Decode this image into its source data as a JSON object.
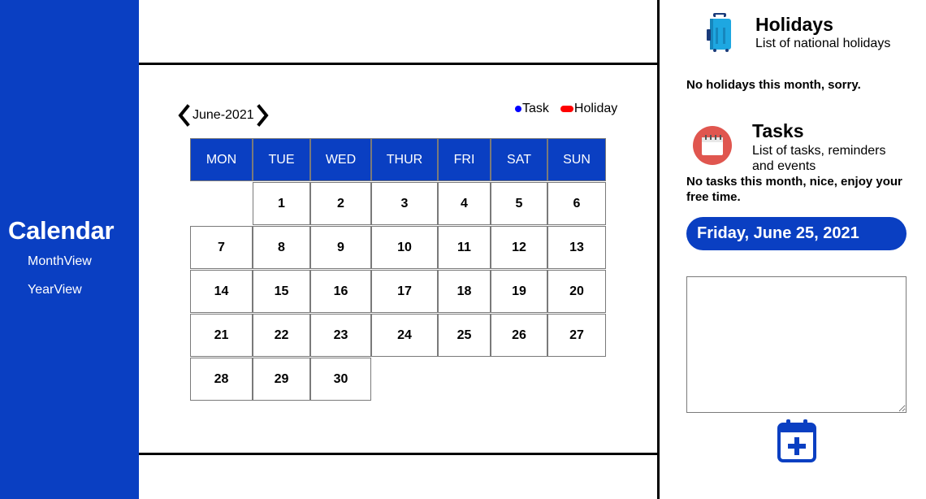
{
  "sidebar": {
    "title": "Calendar",
    "nav": [
      {
        "label": "MonthView"
      },
      {
        "label": "YearView"
      }
    ]
  },
  "calendar": {
    "month_label": "June-2021",
    "legend": {
      "task": "Task",
      "holiday": "Holiday"
    },
    "weekdays": [
      "MON",
      "TUE",
      "WED",
      "THUR",
      "FRI",
      "SAT",
      "SUN"
    ],
    "weeks": [
      [
        "",
        "1",
        "2",
        "3",
        "4",
        "5",
        "6"
      ],
      [
        "7",
        "8",
        "9",
        "10",
        "11",
        "12",
        "13"
      ],
      [
        "14",
        "15",
        "16",
        "17",
        "18",
        "19",
        "20"
      ],
      [
        "21",
        "22",
        "23",
        "24",
        "25",
        "26",
        "27"
      ],
      [
        "28",
        "29",
        "30",
        "",
        "",
        "",
        ""
      ]
    ]
  },
  "holidays": {
    "title": "Holidays",
    "subtitle": "List of national holidays",
    "empty_message": "No holidays this month, sorry."
  },
  "tasks": {
    "title": "Tasks",
    "subtitle": "List of tasks, reminders and events",
    "empty_message": "No tasks this month, nice, enjoy your free time."
  },
  "selected_date": "Friday, June 25, 2021",
  "colors": {
    "accent": "#0a3fc2",
    "task_dot": "#0000ff",
    "holiday_dot": "#ff0000"
  },
  "icons": {
    "holidays": "suitcase-icon",
    "tasks": "calendar-icon",
    "add": "calendar-plus-icon"
  }
}
